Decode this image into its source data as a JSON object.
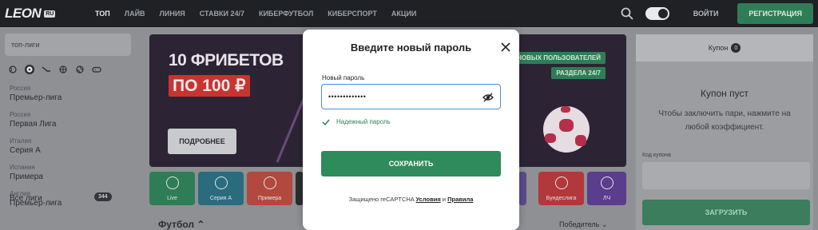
{
  "header": {
    "logo_text": "LEON",
    "logo_badge": "RU",
    "nav": [
      "ТОП",
      "ЛАЙВ",
      "ЛИНИЯ",
      "СТАВКИ 24/7",
      "КИБЕРФУТБОЛ",
      "КИБЕРСПОРТ",
      "АКЦИИ"
    ],
    "login_label": "ВОЙТИ",
    "register_label": "РЕГИСТРАЦИЯ"
  },
  "sidebar": {
    "search_placeholder": "топ-лиги",
    "sport_icons": [
      "tennis-icon",
      "football-icon",
      "hockey-icon",
      "basketball-icon",
      "volleyball-icon",
      "esports-icon"
    ],
    "leagues": [
      {
        "country": "Россия",
        "name": "Премьер-лига"
      },
      {
        "country": "Россия",
        "name": "Первая Лига"
      },
      {
        "country": "Италия",
        "name": "Серия А"
      },
      {
        "country": "Испания",
        "name": "Примера"
      },
      {
        "country": "Англия",
        "name": "Премьер-лига"
      }
    ],
    "all_leagues_label": "Все лиги",
    "all_leagues_count": "344"
  },
  "banner": {
    "title": "10 ФРИБЕТОВ",
    "subtitle": "ПО 100 ₽",
    "more_button": "ПОДРОБНЕЕ",
    "tag_new_users": "НОВЫХ ПОЛЬЗОВАТЕЛЕЙ",
    "tag_section": "РАЗДЕЛА 24/7"
  },
  "tiles": [
    {
      "label": "Live",
      "color": "#2f7d57"
    },
    {
      "label": "Серия А",
      "color": "#2a6c7e"
    },
    {
      "label": "Примера",
      "color": "#b2483e"
    },
    {
      "label": "",
      "color": "#2b2d31"
    },
    {
      "label": "",
      "color": "#2b2d31"
    },
    {
      "label": "",
      "color": "#2b2d31"
    },
    {
      "label": "",
      "color": "#2b2d31"
    },
    {
      "label": "",
      "color": "#2b2d31"
    },
    {
      "label": "Бундеслига",
      "color": "#b2383c"
    },
    {
      "label": "ЛЧ",
      "color": "#5a3d8c"
    }
  ],
  "main": {
    "section_title": "Футбол",
    "market_select": "Победитель"
  },
  "coupon": {
    "header_label": "Купон",
    "count": "0",
    "empty_title": "Купон пуст",
    "empty_hint": "Чтобы заключить пари, нажмите на любой коэффициент.",
    "code_label": "Код купона",
    "load_button": "ЗАГРУЗИТЬ"
  },
  "modal": {
    "title": "Введите новый пароль",
    "password_label": "Новый пароль",
    "password_value": "•••••••••••••",
    "strength_text": "Надежный пароль",
    "save_button": "СОХРАНИТЬ",
    "captcha_prefix": "Защищено reCAPTCHA",
    "captcha_terms": "Условия",
    "captcha_and": "и",
    "captcha_rules": "Правила"
  },
  "colors": {
    "accent_green": "#2f8a5c",
    "focus_blue": "#4c8fd6",
    "topbar": "#1f2124"
  }
}
